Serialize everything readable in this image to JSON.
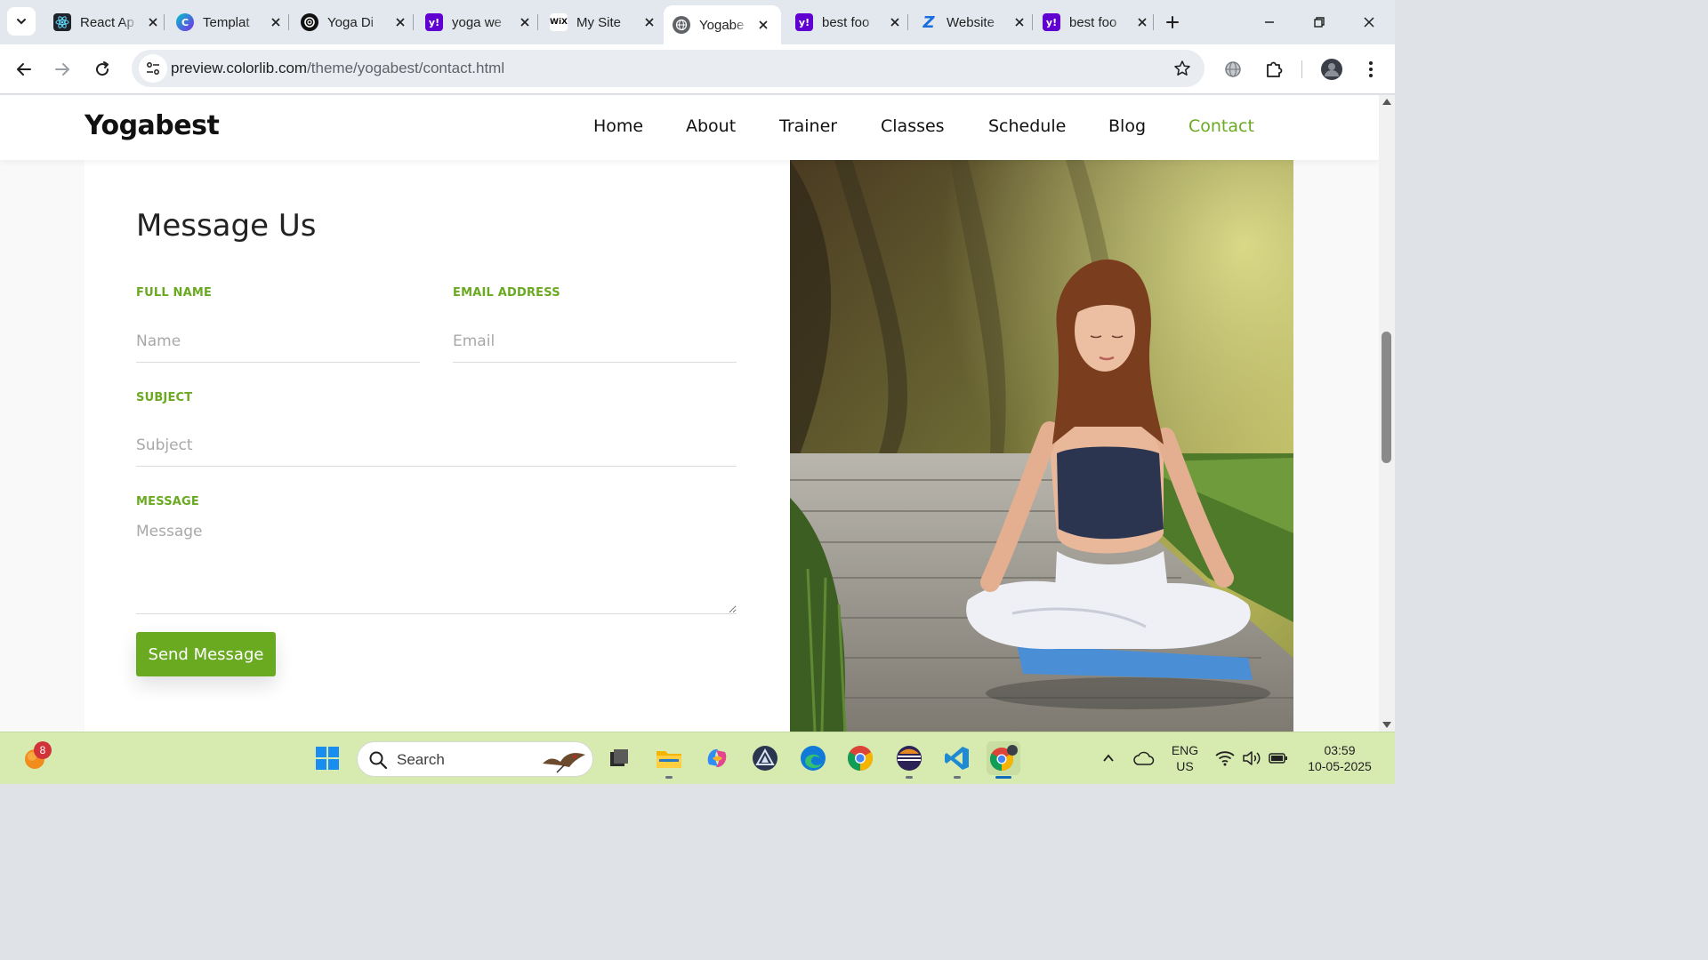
{
  "browser": {
    "tabs": [
      {
        "title": "React Ap",
        "icon": "react-icon",
        "active": false
      },
      {
        "title": "Templat",
        "icon": "canva-icon",
        "active": false
      },
      {
        "title": "Yoga Di",
        "icon": "openai-icon",
        "active": false
      },
      {
        "title": "yoga we",
        "icon": "yahoo-icon",
        "active": false
      },
      {
        "title": "My Site",
        "icon": "wix-icon",
        "active": false
      },
      {
        "title": "Yogabe",
        "icon": "globe-icon",
        "active": true
      },
      {
        "title": "best foo",
        "icon": "yahoo-icon",
        "active": false
      },
      {
        "title": "Website",
        "icon": "zety-icon",
        "active": false
      },
      {
        "title": "best foo",
        "icon": "yahoo-icon",
        "active": false
      }
    ],
    "url_host": "preview.colorlib.com",
    "url_path": "/theme/yogabest/contact.html"
  },
  "site": {
    "logo": "Yogabest",
    "nav": [
      {
        "label": "Home",
        "active": false
      },
      {
        "label": "About",
        "active": false
      },
      {
        "label": "Trainer",
        "active": false
      },
      {
        "label": "Classes",
        "active": false
      },
      {
        "label": "Schedule",
        "active": false
      },
      {
        "label": "Blog",
        "active": false
      },
      {
        "label": "Contact",
        "active": true
      }
    ],
    "accent_color": "#6aaa21"
  },
  "form": {
    "title": "Message Us",
    "full_name_label": "FULL NAME",
    "full_name_placeholder": "Name",
    "email_label": "EMAIL ADDRESS",
    "email_placeholder": "Email",
    "subject_label": "SUBJECT",
    "subject_placeholder": "Subject",
    "message_label": "MESSAGE",
    "message_placeholder": "Message",
    "submit_label": "Send Message"
  },
  "taskbar": {
    "notification_count": "8",
    "search_label": "Search",
    "language_primary": "ENG",
    "language_secondary": "US",
    "time": "03:59",
    "date": "10-05-2025"
  }
}
